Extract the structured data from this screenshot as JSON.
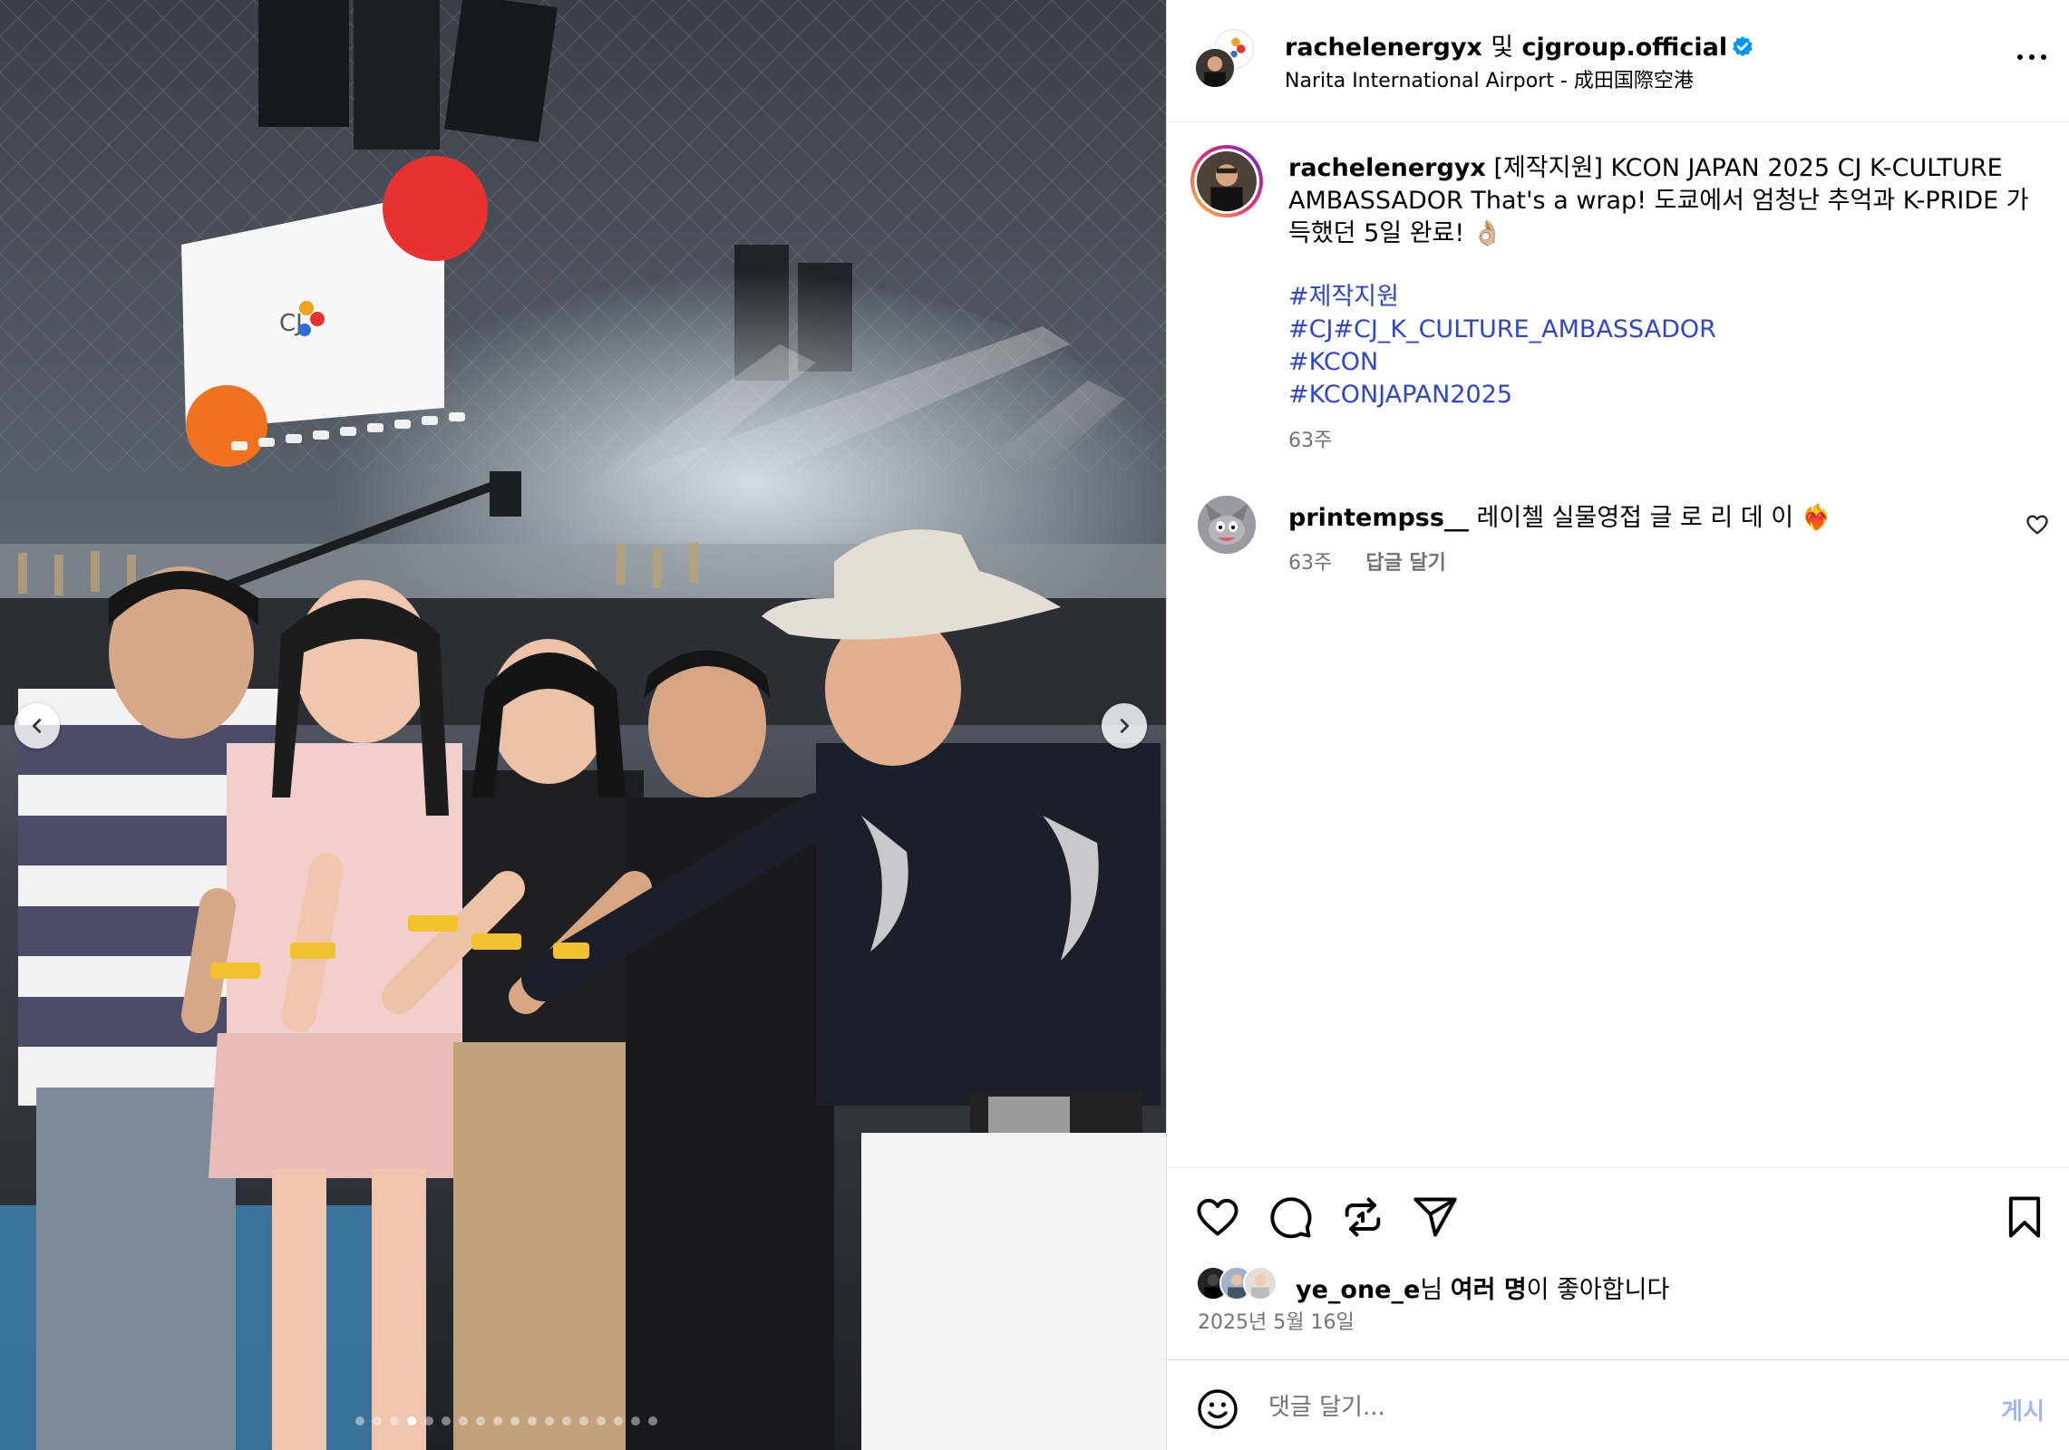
{
  "media": {
    "screen_logo": "CJ",
    "dot_count": 18,
    "active_dot": 3
  },
  "header": {
    "username": "rachelenergyx",
    "conjunction": "및",
    "collaborator": "cjgroup.official",
    "location": "Narita International Airport - 成田国際空港"
  },
  "caption": {
    "username": "rachelenergyx",
    "text": "[제작지원] KCON JAPAN 2025 CJ K-CULTURE AMBASSADOR That's a wrap! 도쿄에서 엄청난 추억과 K-PRIDE 가득했던 5일 완료! 👌🏼",
    "hashtags": [
      "#제작지원",
      "#CJ#CJ_K_CULTURE_AMBASSADOR",
      "#KCON",
      "#KCONJAPAN2025"
    ],
    "time": "63주"
  },
  "comment": {
    "username": "printempss__",
    "text": "레이첼 실물영접 글 로 리 데 이 ❤️‍🔥",
    "time": "63주",
    "reply_label": "답글 달기"
  },
  "likes": {
    "user": "ye_one_e",
    "suffix_pre": "님 ",
    "suffix_bold": "여러 명",
    "suffix_post": "이 좋아합니다"
  },
  "post_date": "2025년 5월 16일",
  "add_comment": {
    "placeholder": "댓글 달기...",
    "post_label": "게시"
  },
  "icons": {
    "like": "heart-icon",
    "comment": "speech-bubble-icon",
    "repost": "repost-icon",
    "share": "paper-plane-icon",
    "save": "bookmark-icon",
    "emoji": "smiley-icon",
    "more": "more-horizontal-icon",
    "verified": "verified-badge-icon"
  },
  "colors": {
    "hashtag": "#2e47c8",
    "verified": "#0095f6",
    "secondary_text": "#737373",
    "post_button": "#9fb8ec"
  }
}
